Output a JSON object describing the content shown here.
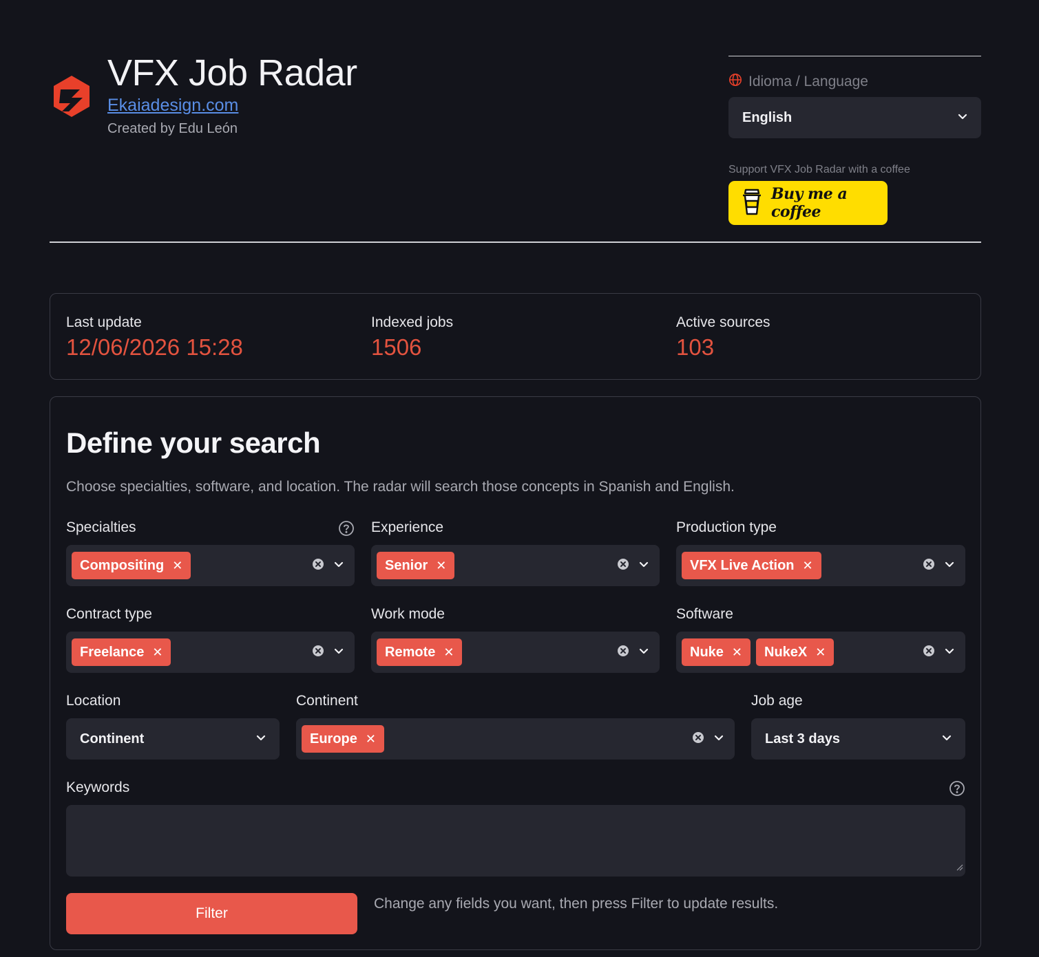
{
  "header": {
    "title": "VFX Job Radar",
    "site_link": "Ekaiadesign.com",
    "created_by": "Created by Edu León"
  },
  "language": {
    "label": "Idioma / Language",
    "selected": "English"
  },
  "coffee": {
    "label": "Support VFX Job Radar with a coffee",
    "button_text": "Buy me a coffee"
  },
  "stats": {
    "last_update_label": "Last update",
    "last_update_value": "12/06/2026 15:28",
    "indexed_jobs_label": "Indexed jobs",
    "indexed_jobs_value": "1506",
    "active_sources_label": "Active sources",
    "active_sources_value": "103"
  },
  "search": {
    "title": "Define your search",
    "description": "Choose specialties, software, and location. The radar will search those concepts in Spanish and English.",
    "specialties": {
      "label": "Specialties",
      "chips": [
        "Compositing"
      ]
    },
    "experience": {
      "label": "Experience",
      "chips": [
        "Senior"
      ]
    },
    "production_type": {
      "label": "Production type",
      "chips": [
        "VFX Live Action"
      ]
    },
    "contract_type": {
      "label": "Contract type",
      "chips": [
        "Freelance"
      ]
    },
    "work_mode": {
      "label": "Work mode",
      "chips": [
        "Remote"
      ]
    },
    "software": {
      "label": "Software",
      "chips": [
        "Nuke",
        "NukeX"
      ]
    },
    "location": {
      "label": "Location",
      "selected": "Continent"
    },
    "continent": {
      "label": "Continent",
      "chips": [
        "Europe"
      ]
    },
    "job_age": {
      "label": "Job age",
      "selected": "Last 3 days"
    },
    "keywords": {
      "label": "Keywords",
      "value": ""
    },
    "filter_button": "Filter",
    "filter_hint": "Change any fields you want, then press Filter to update results."
  },
  "colors": {
    "accent": "#e8584b",
    "background": "#13141b",
    "field_bg": "#262730",
    "coffee_yellow": "#ffdd00"
  }
}
